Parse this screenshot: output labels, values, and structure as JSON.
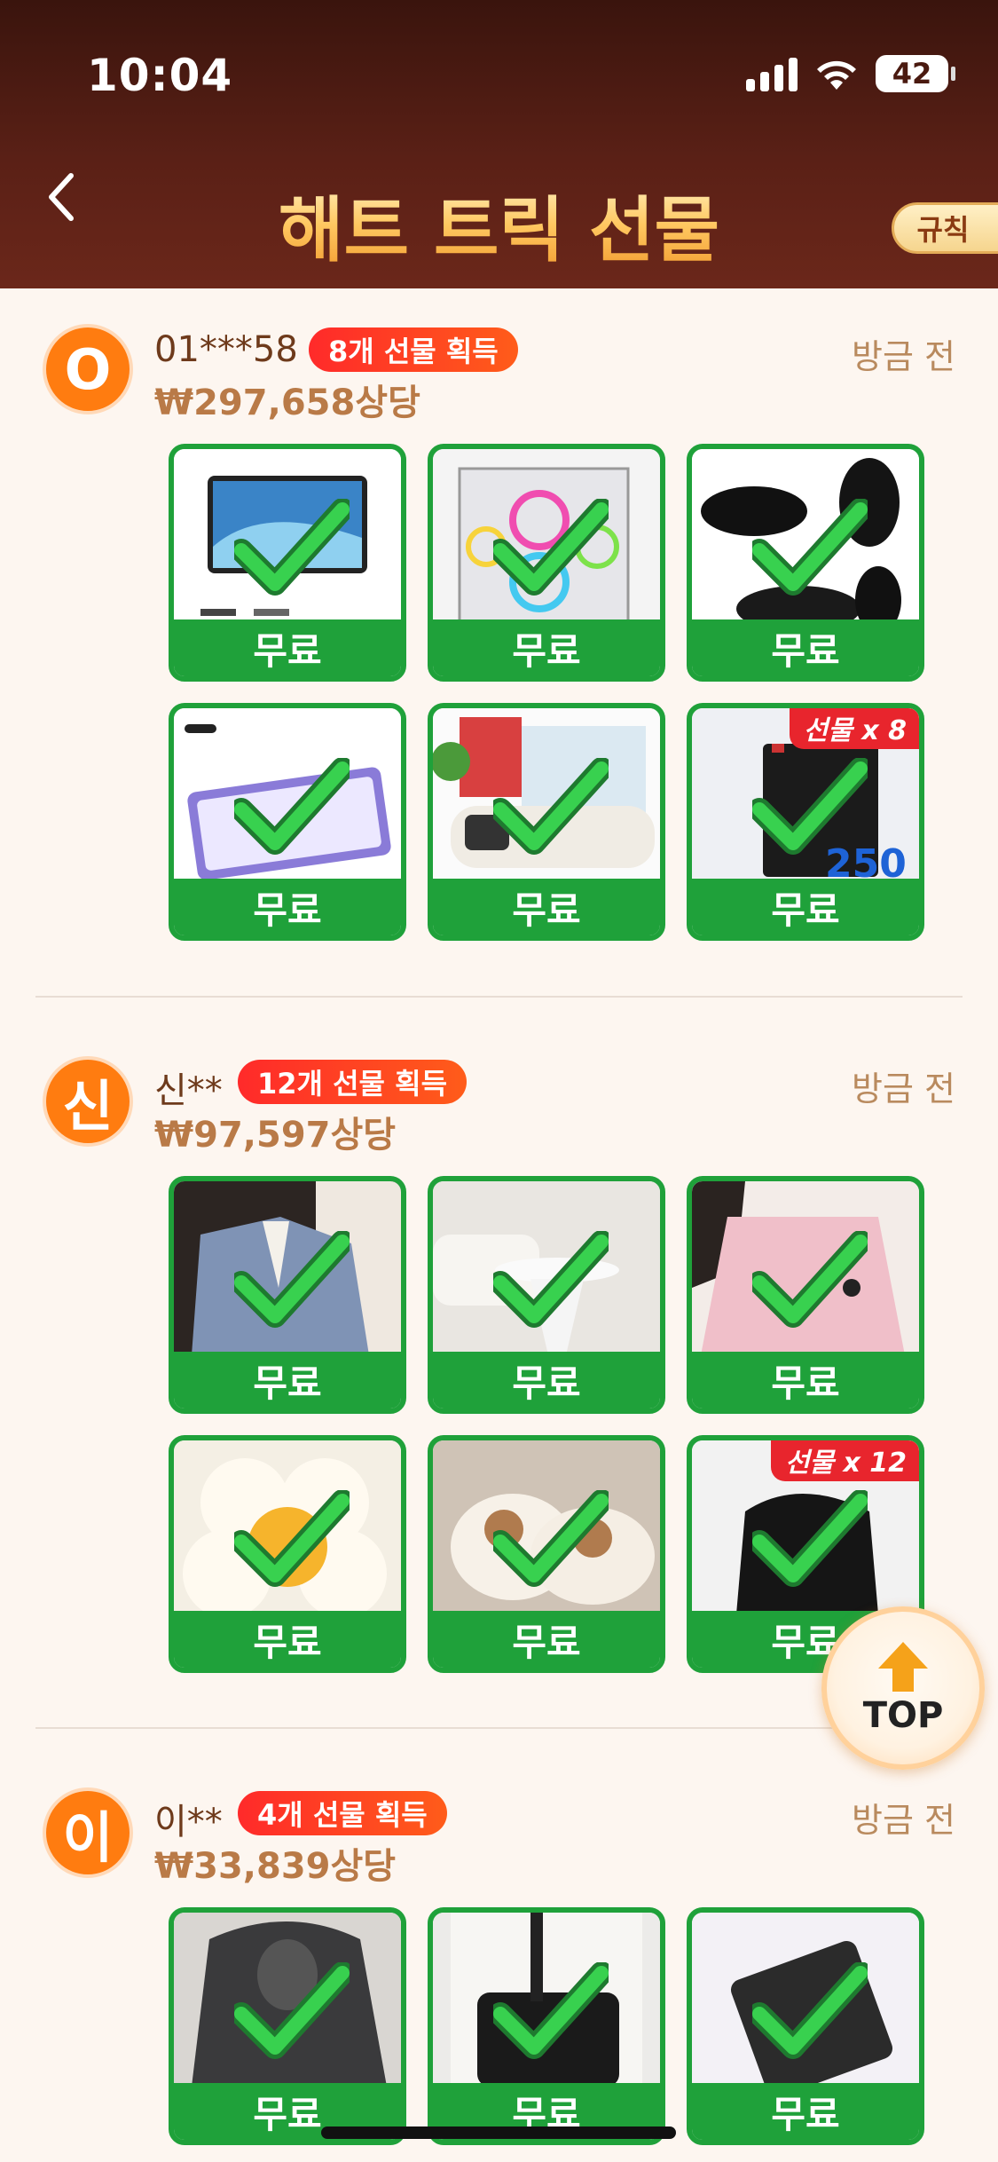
{
  "status_bar": {
    "time": "10:04",
    "battery": "42"
  },
  "header": {
    "title": "해트 트릭 선물",
    "rules_label": "규칙"
  },
  "records": [
    {
      "avatar": "O",
      "user": "01***58",
      "badge": "8개 선물 획득",
      "value": "₩297,658상당",
      "time": "방금 전",
      "gift_tag": "선물 x 8",
      "items": [
        "무료",
        "무료",
        "무료",
        "무료",
        "무료",
        "무료"
      ]
    },
    {
      "avatar": "신",
      "user": "신**",
      "badge": "12개 선물 획득",
      "value": "₩97,597상당",
      "time": "방금 전",
      "gift_tag": "선물 x 12",
      "items": [
        "무료",
        "무료",
        "무료",
        "무료",
        "무료",
        "무료"
      ]
    },
    {
      "avatar": "이",
      "user": "이**",
      "badge": "4개 선물 획득",
      "value": "₩33,839상당",
      "time": "방금 전",
      "items": [
        "무료",
        "무료",
        "무료"
      ]
    }
  ],
  "top_button": {
    "label": "TOP"
  },
  "colors": {
    "accent_green": "#1fa13a",
    "badge_red": "#ff2a2a",
    "avatar_orange": "#ff7c10",
    "header_brown": "#5a2016"
  }
}
